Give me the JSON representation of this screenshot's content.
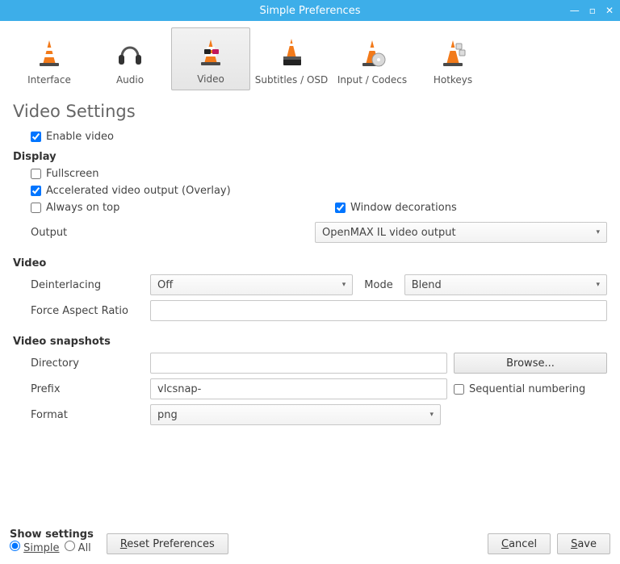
{
  "title": "Simple Preferences",
  "tabs": {
    "interface": "Interface",
    "audio": "Audio",
    "video": "Video",
    "subtitles": "Subtitles / OSD",
    "input_codecs": "Input / Codecs",
    "hotkeys": "Hotkeys"
  },
  "page_title": "Video Settings",
  "enable_video": "Enable video",
  "display": {
    "heading": "Display",
    "fullscreen": "Fullscreen",
    "accelerated": "Accelerated video output (Overlay)",
    "always_on_top": "Always on top",
    "window_decorations": "Window decorations",
    "output_label": "Output",
    "output_value": "OpenMAX IL video output"
  },
  "video": {
    "heading": "Video",
    "deinterlacing_label": "Deinterlacing",
    "deinterlacing_value": "Off",
    "mode_label": "Mode",
    "mode_value": "Blend",
    "far_label": "Force Aspect Ratio",
    "far_value": ""
  },
  "snapshots": {
    "heading": "Video snapshots",
    "directory_label": "Directory",
    "directory_value": "",
    "browse": "Browse...",
    "prefix_label": "Prefix",
    "prefix_value": "vlcsnap-",
    "sequential": "Sequential numbering",
    "format_label": "Format",
    "format_value": "png"
  },
  "footer": {
    "show_settings": "Show settings",
    "simple": "Simple",
    "all": "All",
    "reset": "Reset Preferences",
    "cancel": "Cancel",
    "save": "Save"
  }
}
